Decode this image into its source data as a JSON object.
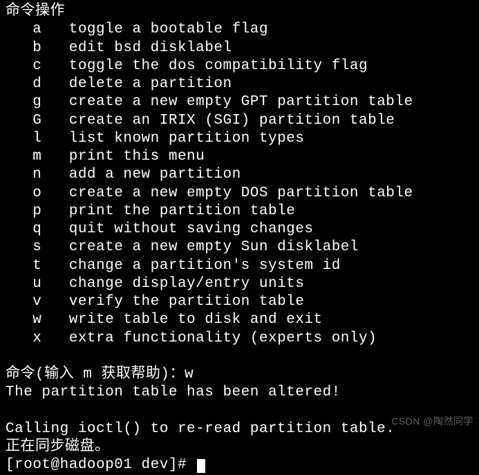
{
  "header": "命令操作",
  "commands": [
    {
      "key": "a",
      "desc": "toggle a bootable flag"
    },
    {
      "key": "b",
      "desc": "edit bsd disklabel"
    },
    {
      "key": "c",
      "desc": "toggle the dos compatibility flag"
    },
    {
      "key": "d",
      "desc": "delete a partition"
    },
    {
      "key": "g",
      "desc": "create a new empty GPT partition table"
    },
    {
      "key": "G",
      "desc": "create an IRIX (SGI) partition table"
    },
    {
      "key": "l",
      "desc": "list known partition types"
    },
    {
      "key": "m",
      "desc": "print this menu"
    },
    {
      "key": "n",
      "desc": "add a new partition"
    },
    {
      "key": "o",
      "desc": "create a new empty DOS partition table"
    },
    {
      "key": "p",
      "desc": "print the partition table"
    },
    {
      "key": "q",
      "desc": "quit without saving changes"
    },
    {
      "key": "s",
      "desc": "create a new empty Sun disklabel"
    },
    {
      "key": "t",
      "desc": "change a partition's system id"
    },
    {
      "key": "u",
      "desc": "change display/entry units"
    },
    {
      "key": "v",
      "desc": "verify the partition table"
    },
    {
      "key": "w",
      "desc": "write table to disk and exit"
    },
    {
      "key": "x",
      "desc": "extra functionality (experts only)"
    }
  ],
  "prompt_label": "命令(输入 m 获取帮助)：",
  "prompt_input": "w",
  "result_line1": "The partition table has been altered!",
  "result_line2": "Calling ioctl() to re-read partition table.",
  "result_line3": "正在同步磁盘。",
  "shell_prompt_open": "[",
  "shell_user": "root@hadoop01",
  "shell_path": " dev",
  "shell_prompt_close": "]# ",
  "watermark": "CSDN @陶然同学"
}
